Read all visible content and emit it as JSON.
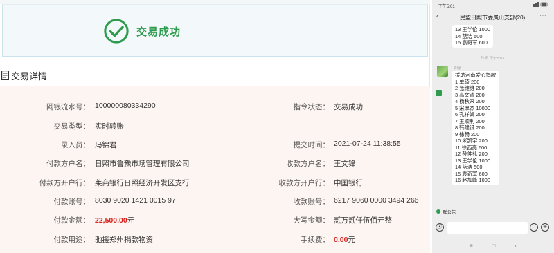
{
  "result": {
    "title": "交易成功"
  },
  "details": {
    "title": "交易详情",
    "left": [
      {
        "label": "网银流水号：",
        "value": "100000080334290"
      },
      {
        "label": "交易类型：",
        "value": "实时转账"
      },
      {
        "label": "录入员：",
        "value": "冯锦君"
      },
      {
        "label": "付款方户名：",
        "value": "日照市鲁豫市场管理有限公司"
      },
      {
        "label": "付款方开户行：",
        "value": "莱商银行日照经济开发区支行"
      },
      {
        "label": "付款账号：",
        "value": "8030 9020 1421 0015 97"
      },
      {
        "label": "付款金额：",
        "value": "22,500.00",
        "suffix": "元"
      },
      {
        "label": "付款用途：",
        "value": "驰援郑州捐款物资"
      }
    ],
    "right": [
      {
        "label": "指令状态：",
        "value": "交易成功"
      },
      {
        "label": "提交时间：",
        "value": "2021-07-24 11:38:55"
      },
      {
        "label": "收款方户名：",
        "value": "王文锋"
      },
      {
        "label": "收款方开户行：",
        "value": "中国银行"
      },
      {
        "label": "收款账号：",
        "value": "6217 9060 0000 3494 266"
      },
      {
        "label": "大写金额：",
        "value": "贰万贰仟伍佰元整"
      },
      {
        "label": "手续费：",
        "value": "0.00",
        "suffix": "元"
      }
    ]
  },
  "phone": {
    "status_time": "下午5:01",
    "chat_title": "民盟日照市委岚山支部(20)",
    "prev_bubble": [
      "13 王学伦 1000",
      "14 蓝洁 500",
      "15 袁奇军 600"
    ],
    "timestamp": "昨天 下午5:03",
    "sender": "青绿",
    "message": [
      "援助河南爱心捐款",
      "1 单琦 200",
      "2 张维维 200",
      "3 高文清 200",
      "4 杨秋来 200",
      "5 宋厚杰 10000",
      "6 孔祥娟 200",
      "7 王顺利 200",
      "8 韩建设 200",
      "9 徐畅 200",
      "10 米凯宇 200",
      "11 徐西亮 600",
      "12 孙仲礼 200",
      "13 王学伦 1000",
      "14 蓝洁 500",
      "15 袁奇军 600",
      "16 赵加峰 1000"
    ],
    "notice": "群公告"
  }
}
